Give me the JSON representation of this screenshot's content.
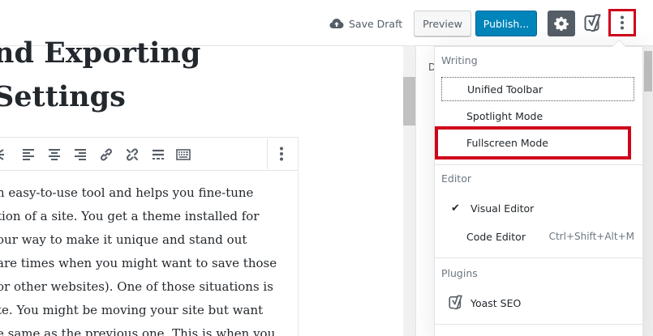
{
  "header": {
    "save_draft_label": "Save Draft",
    "preview_label": "Preview",
    "publish_label": "Publish...",
    "settings_icon": "gear-icon",
    "yoast_icon": "yoast-icon",
    "more_icon": "more-vertical-icon"
  },
  "post": {
    "title_lines": [
      "nd Exporting",
      "Settings"
    ],
    "paragraph_lines": [
      "n easy-to-use tool and helps you fine-tune",
      "tion of a site. You get a theme installed for",
      "our way to make it unique and stand out",
      "are times when you might want to save those",
      "or other websites). One of those situations is",
      "te. You might be moving your site but want",
      "e same as the previous one. This is when you"
    ]
  },
  "block_toolbar": {
    "icons": [
      "strikethrough-icon",
      "align-left-icon",
      "align-center-icon",
      "align-right-icon",
      "link-icon",
      "unlink-icon",
      "read-more-icon",
      "toolbar-toggle-icon"
    ],
    "more_icon": "more-vertical-icon"
  },
  "sidebar": {
    "tab_partial": "D"
  },
  "menu": {
    "writing": {
      "title": "Writing",
      "items": [
        "Unified Toolbar",
        "Spotlight Mode",
        "Fullscreen Mode"
      ]
    },
    "editor": {
      "title": "Editor",
      "items": [
        {
          "label": "Visual Editor",
          "checked": true,
          "shortcut": ""
        },
        {
          "label": "Code Editor",
          "checked": false,
          "shortcut": "Ctrl+Shift+Alt+M"
        }
      ],
      "check_glyph": "✔"
    },
    "plugins": {
      "title": "Plugins",
      "items": [
        "Yoast SEO"
      ]
    }
  },
  "colors": {
    "publish_blue": "#0085ba",
    "highlight_red": "#d0021b",
    "settings_dark": "#555d66"
  }
}
